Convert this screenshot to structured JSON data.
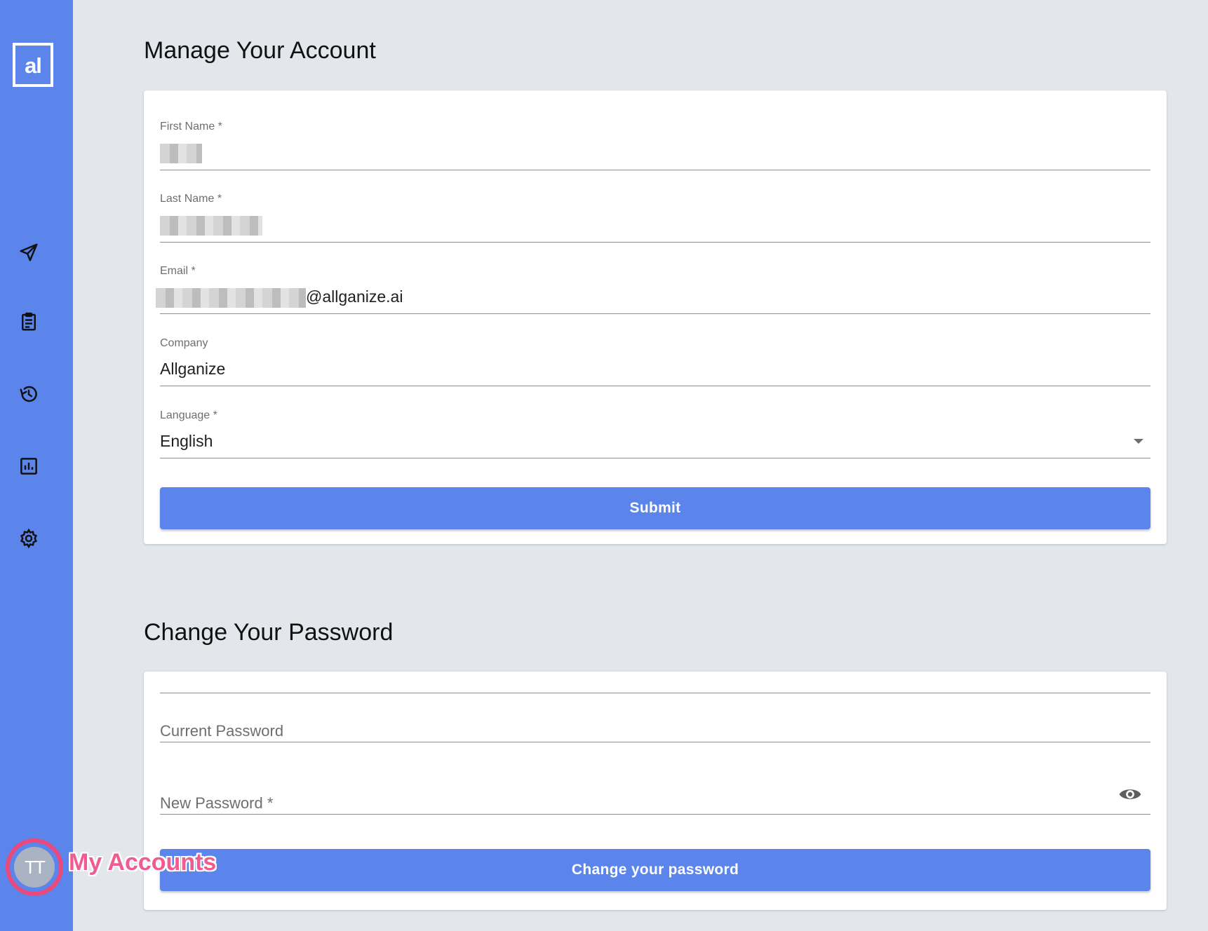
{
  "sidebar": {
    "logo": "al",
    "nav": [
      {
        "icon": "send-icon"
      },
      {
        "icon": "clipboard-icon"
      },
      {
        "icon": "history-icon"
      },
      {
        "icon": "bar-chart-icon"
      },
      {
        "icon": "gear-icon"
      }
    ],
    "avatar_initials": "TT",
    "annotation": "My Accounts"
  },
  "account": {
    "title": "Manage Your Account",
    "first_name_label": "First Name *",
    "last_name_label": "Last Name *",
    "email_label": "Email *",
    "email_suffix": "@allganize.ai",
    "company_label": "Company",
    "company_value": "Allganize",
    "language_label": "Language *",
    "language_value": "English",
    "submit_label": "Submit"
  },
  "password": {
    "title": "Change Your Password",
    "current_label": "Current Password",
    "new_label": "New Password *",
    "button_label": "Change your password"
  },
  "colors": {
    "accent": "#5b85ea",
    "background": "#e3e7eb",
    "annotation": "#f05c8f"
  }
}
